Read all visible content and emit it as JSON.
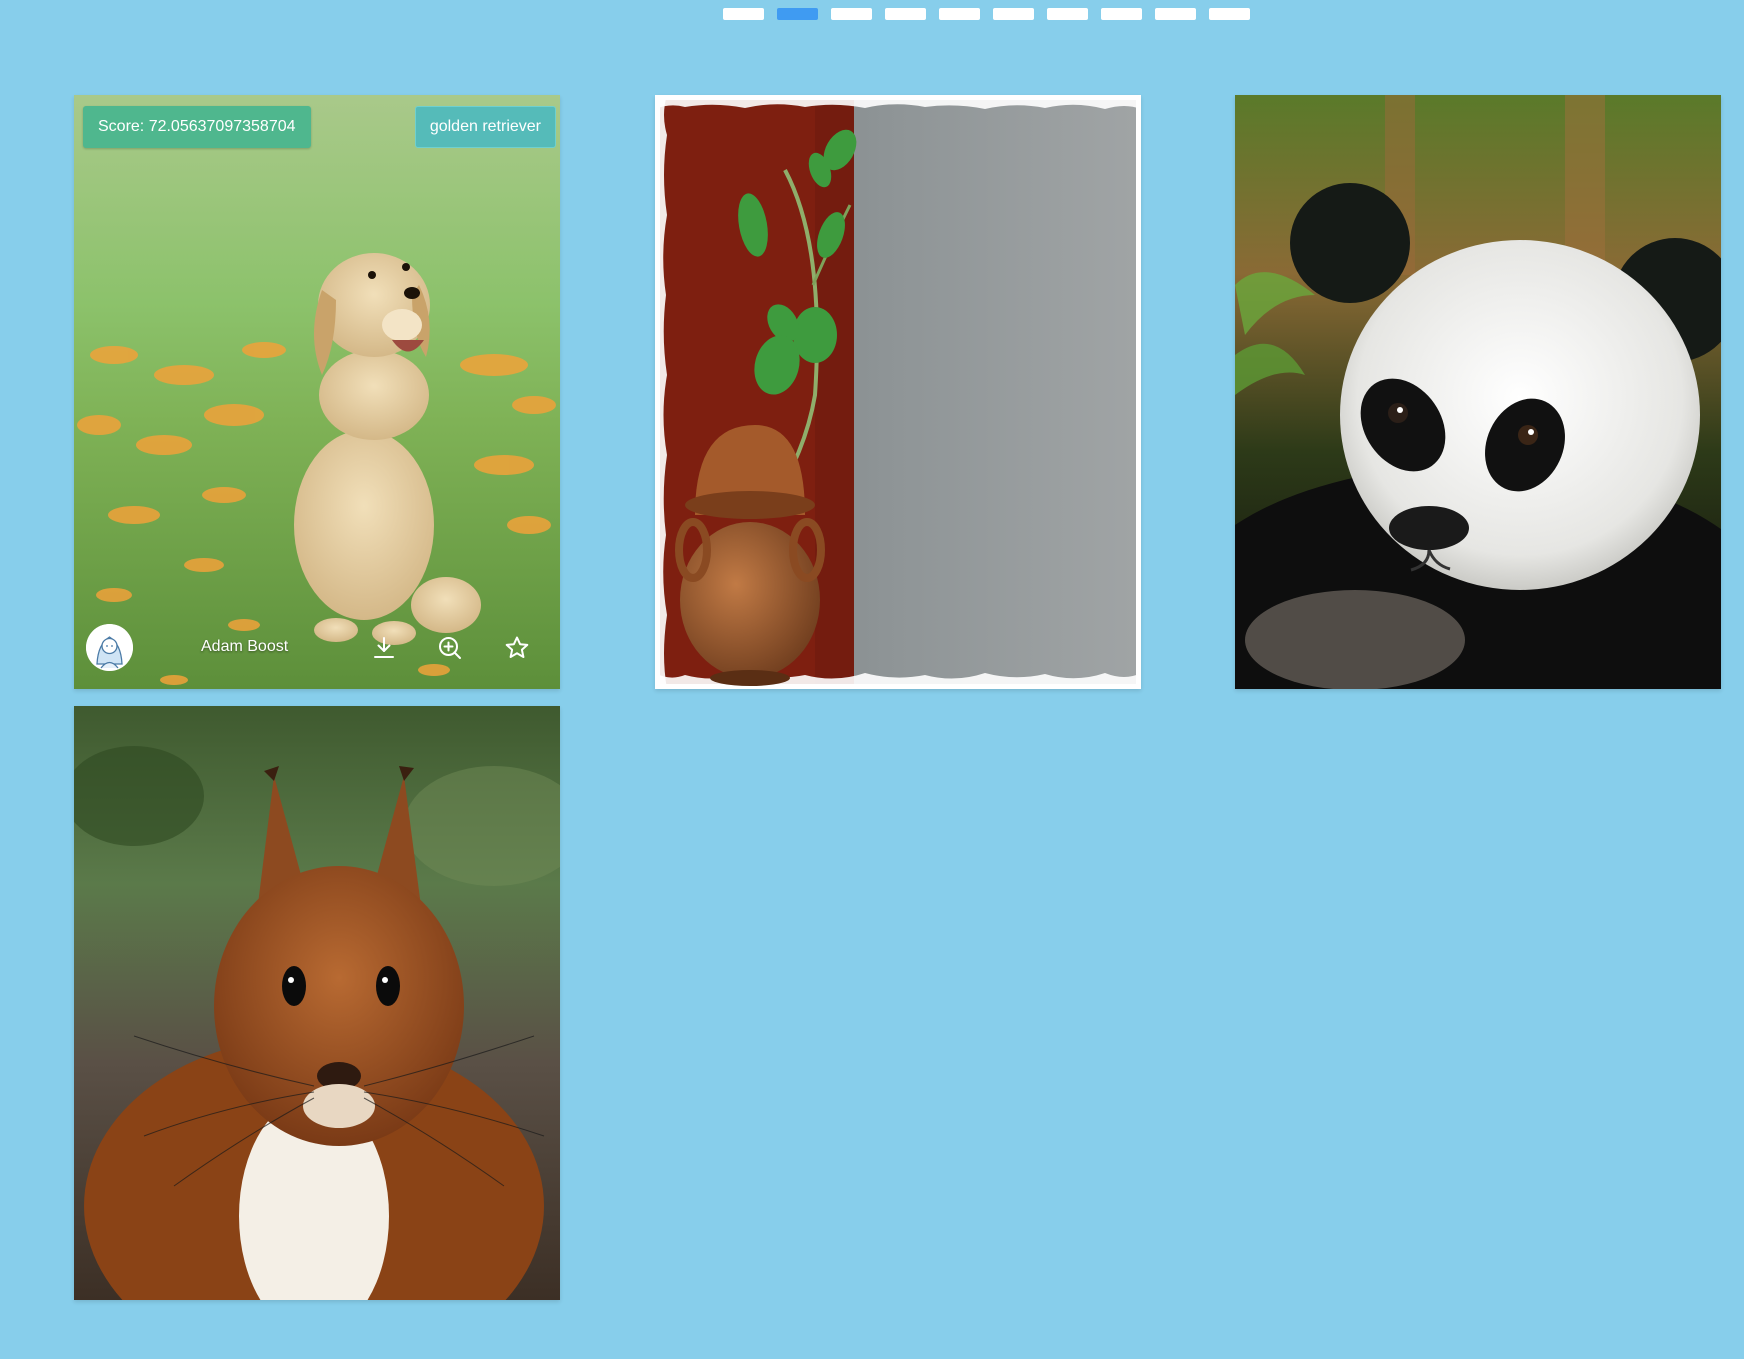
{
  "pagination": {
    "total": 10,
    "active_index": 1
  },
  "cards": [
    {
      "subject": "golden retriever puppy sitting on grass with orange flowers",
      "score_text": "Score: 72.05637097358704",
      "label": "golden retriever",
      "author": "Adam Boost"
    },
    {
      "subject": "clay pot with green plant hanging on red and grey wall"
    },
    {
      "subject": "giant panda close-up face"
    },
    {
      "subject": "red squirrel close-up face"
    }
  ],
  "icons": {
    "download": "download-icon",
    "zoom": "zoom-in-icon",
    "favorite": "star-icon",
    "avatar": "user-avatar-icon"
  },
  "colors": {
    "background": "#87CEEB",
    "pager_active": "#3f9bf2",
    "pager_inactive": "#ffffff",
    "score_badge": "#4fb78e",
    "label_badge": "#55bbb9"
  }
}
